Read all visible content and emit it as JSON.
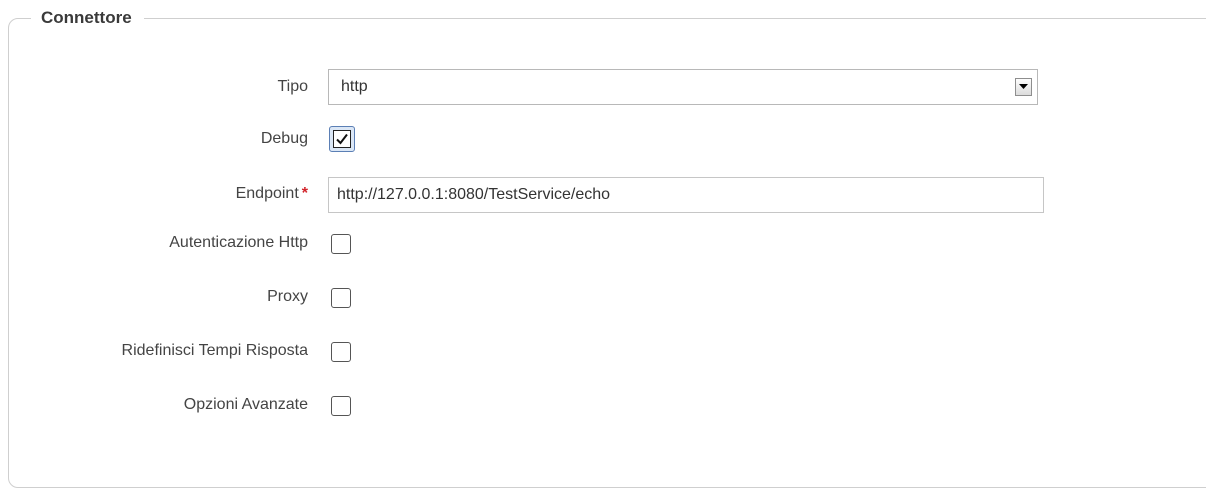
{
  "section": {
    "title": "Connettore"
  },
  "fields": {
    "tipo": {
      "label": "Tipo",
      "value": "http"
    },
    "debug": {
      "label": "Debug",
      "checked": true
    },
    "endpoint": {
      "label": "Endpoint",
      "required_mark": "*",
      "value": "http://127.0.0.1:8080/TestService/echo"
    },
    "autenticazione_http": {
      "label": "Autenticazione Http",
      "checked": false
    },
    "proxy": {
      "label": "Proxy",
      "checked": false
    },
    "ridefinisci_tempi_risposta": {
      "label": "Ridefinisci Tempi Risposta",
      "checked": false
    },
    "opzioni_avanzate": {
      "label": "Opzioni Avanzate",
      "checked": false
    }
  },
  "icons": {
    "select_arrow": "chevron-down-icon",
    "checkmark": "checkmark-icon"
  },
  "colors": {
    "required": "#d2232a",
    "checked_focus": "#dbe7f6"
  }
}
